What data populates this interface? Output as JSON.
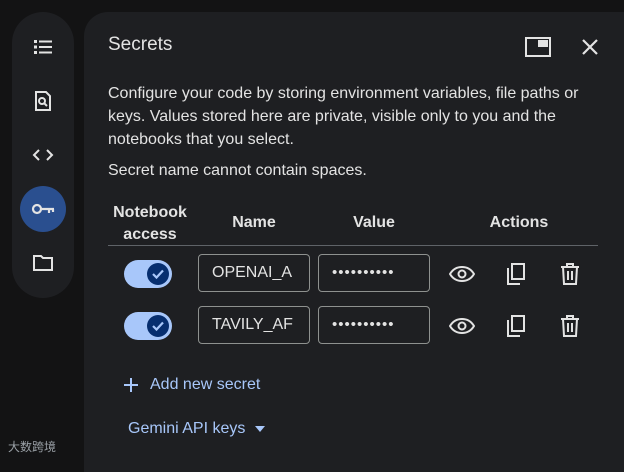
{
  "rail": {
    "items": [
      {
        "icon": "list-icon"
      },
      {
        "icon": "search-doc-icon"
      },
      {
        "icon": "code-icon"
      },
      {
        "icon": "key-icon",
        "active": true
      },
      {
        "icon": "folder-icon"
      }
    ]
  },
  "panel": {
    "title": "Secrets",
    "description": "Configure your code by storing environment variables, file paths or keys. Values stored here are private, visible only to you and the notebooks that you select.",
    "note": "Secret name cannot contain spaces.",
    "columns": {
      "access_line1": "Notebook",
      "access_line2": "access",
      "name": "Name",
      "value": "Value",
      "actions": "Actions"
    },
    "secrets": [
      {
        "enabled": true,
        "name": "OPENAI_A",
        "value": "••••••••••"
      },
      {
        "enabled": true,
        "name": "TAVILY_AF",
        "value": "••••••••••"
      }
    ],
    "add_label": "Add new secret",
    "gemini_label": "Gemini API keys"
  },
  "watermark": "大数跨境",
  "colors": {
    "accent": "#a8c7fa",
    "panel_bg": "#1e1f22",
    "page_bg": "#131314"
  }
}
